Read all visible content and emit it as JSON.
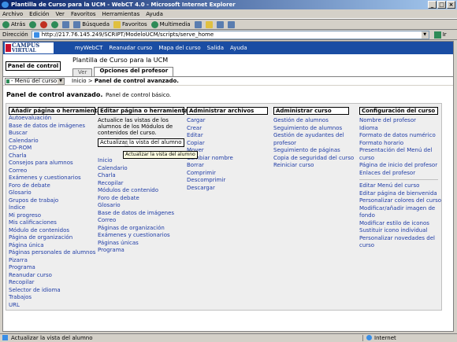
{
  "window": {
    "title": "Plantilla de Curso para la UCM - WebCT 4.0 - Microsoft Internet Explorer"
  },
  "menu": [
    "Archivo",
    "Edición",
    "Ver",
    "Favoritos",
    "Herramientas",
    "Ayuda"
  ],
  "toolbar": {
    "back": "Atrás",
    "search": "Búsqueda",
    "favorites": "Favoritos",
    "multimedia": "Multimedia"
  },
  "address": {
    "label": "Dirección",
    "url": "http://217.76.145.249/SCRIPT/ModeloUCM/scripts/serve_home",
    "go": "Ir"
  },
  "webct": {
    "logo_line1": "CAMPUS",
    "logo_line2": "VIRTUAL",
    "nav": [
      "myWebCT",
      "Reanudar curso",
      "Mapa del curso",
      "Salida",
      "Ayuda"
    ],
    "panel_button": "Panel de control",
    "course_title": "Plantilla de Curso para la UCM",
    "tabs": [
      "Ver",
      "Opciones del profesor"
    ],
    "menu_select": "- Menú del curso -",
    "breadcrumb_start": "Inicio",
    "breadcrumb_sep": ">",
    "breadcrumb_current": "Panel de control avanzado.",
    "page_title": "Panel de control avanzado.",
    "basic_link": "Panel de control básico."
  },
  "columns": {
    "add": {
      "header": "Añadir página o herramienta",
      "items": [
        "Autoevaluación",
        "Base de datos de imágenes",
        "Buscar",
        "Calendario",
        "CD-ROM",
        "Charla",
        "Consejos para alumnos",
        "Correo",
        "Exámenes y cuestionarios",
        "Foro de debate",
        "Glosario",
        "Grupos de trabajo",
        "Índice",
        "Mi progreso",
        "Mis calificaciones",
        "Módulo de contenidos",
        "Página de organización",
        "Página única",
        "Páginas personales de alumnos",
        "Pizarra",
        "Programa",
        "Reanudar curso",
        "Recopilar",
        "Selector de idioma",
        "Trabajos",
        "URL"
      ]
    },
    "edit": {
      "header": "Editar página o herramienta",
      "desc": [
        "Actualice las vistas de los",
        "alumnos de los Módulos de",
        "contenidos del curso."
      ],
      "button": "Actualizar la vista del alumno",
      "items": [
        "Inicio",
        "Calendario",
        "Charla",
        "Recopilar",
        "Módulos de contenido",
        "Foro de debate",
        "Glosario",
        "Base de datos de imágenes",
        "Correo",
        "Páginas de organización",
        "Exámenes y cuestionarios",
        "Páginas únicas",
        "Programa"
      ]
    },
    "files": {
      "header": "Administrar archivos",
      "items": [
        "Cargar",
        "Crear",
        "Editar",
        "Copiar",
        "Mover",
        "Cambiar nombre",
        "Borrar",
        "Comprimir",
        "Descomprimir",
        "Descargar"
      ]
    },
    "course": {
      "header": "Administrar curso",
      "items": [
        "Gestión de alumnos",
        "Seguimiento de alumnos",
        "Gestión de ayudantes del",
        "profesor",
        "Seguimiento de páginas",
        "Copia de seguridad del curso",
        "Reiniciar curso"
      ]
    },
    "config": {
      "header": "Configuración del curso",
      "items1": [
        "Nombre del profesor",
        "Idioma",
        "Formato de datos numérico",
        "Formato horario",
        "Presentación del Menú del",
        "curso",
        "Página de inicio del profesor",
        "Enlaces del profesor"
      ],
      "items2": [
        "Editar Menú del curso",
        "Editar página de bienvenida",
        "Personalizar colores del curso",
        "Modificar/añadir imagen de",
        "fondo",
        "Modificar estilo de iconos",
        "Sustituir icono individual",
        "Personalizar novedades del",
        "curso"
      ]
    }
  },
  "tooltip": "Actualizar la vista del alumno",
  "status": {
    "text": "Actualizar la vista del alumno",
    "zone": "Internet"
  }
}
